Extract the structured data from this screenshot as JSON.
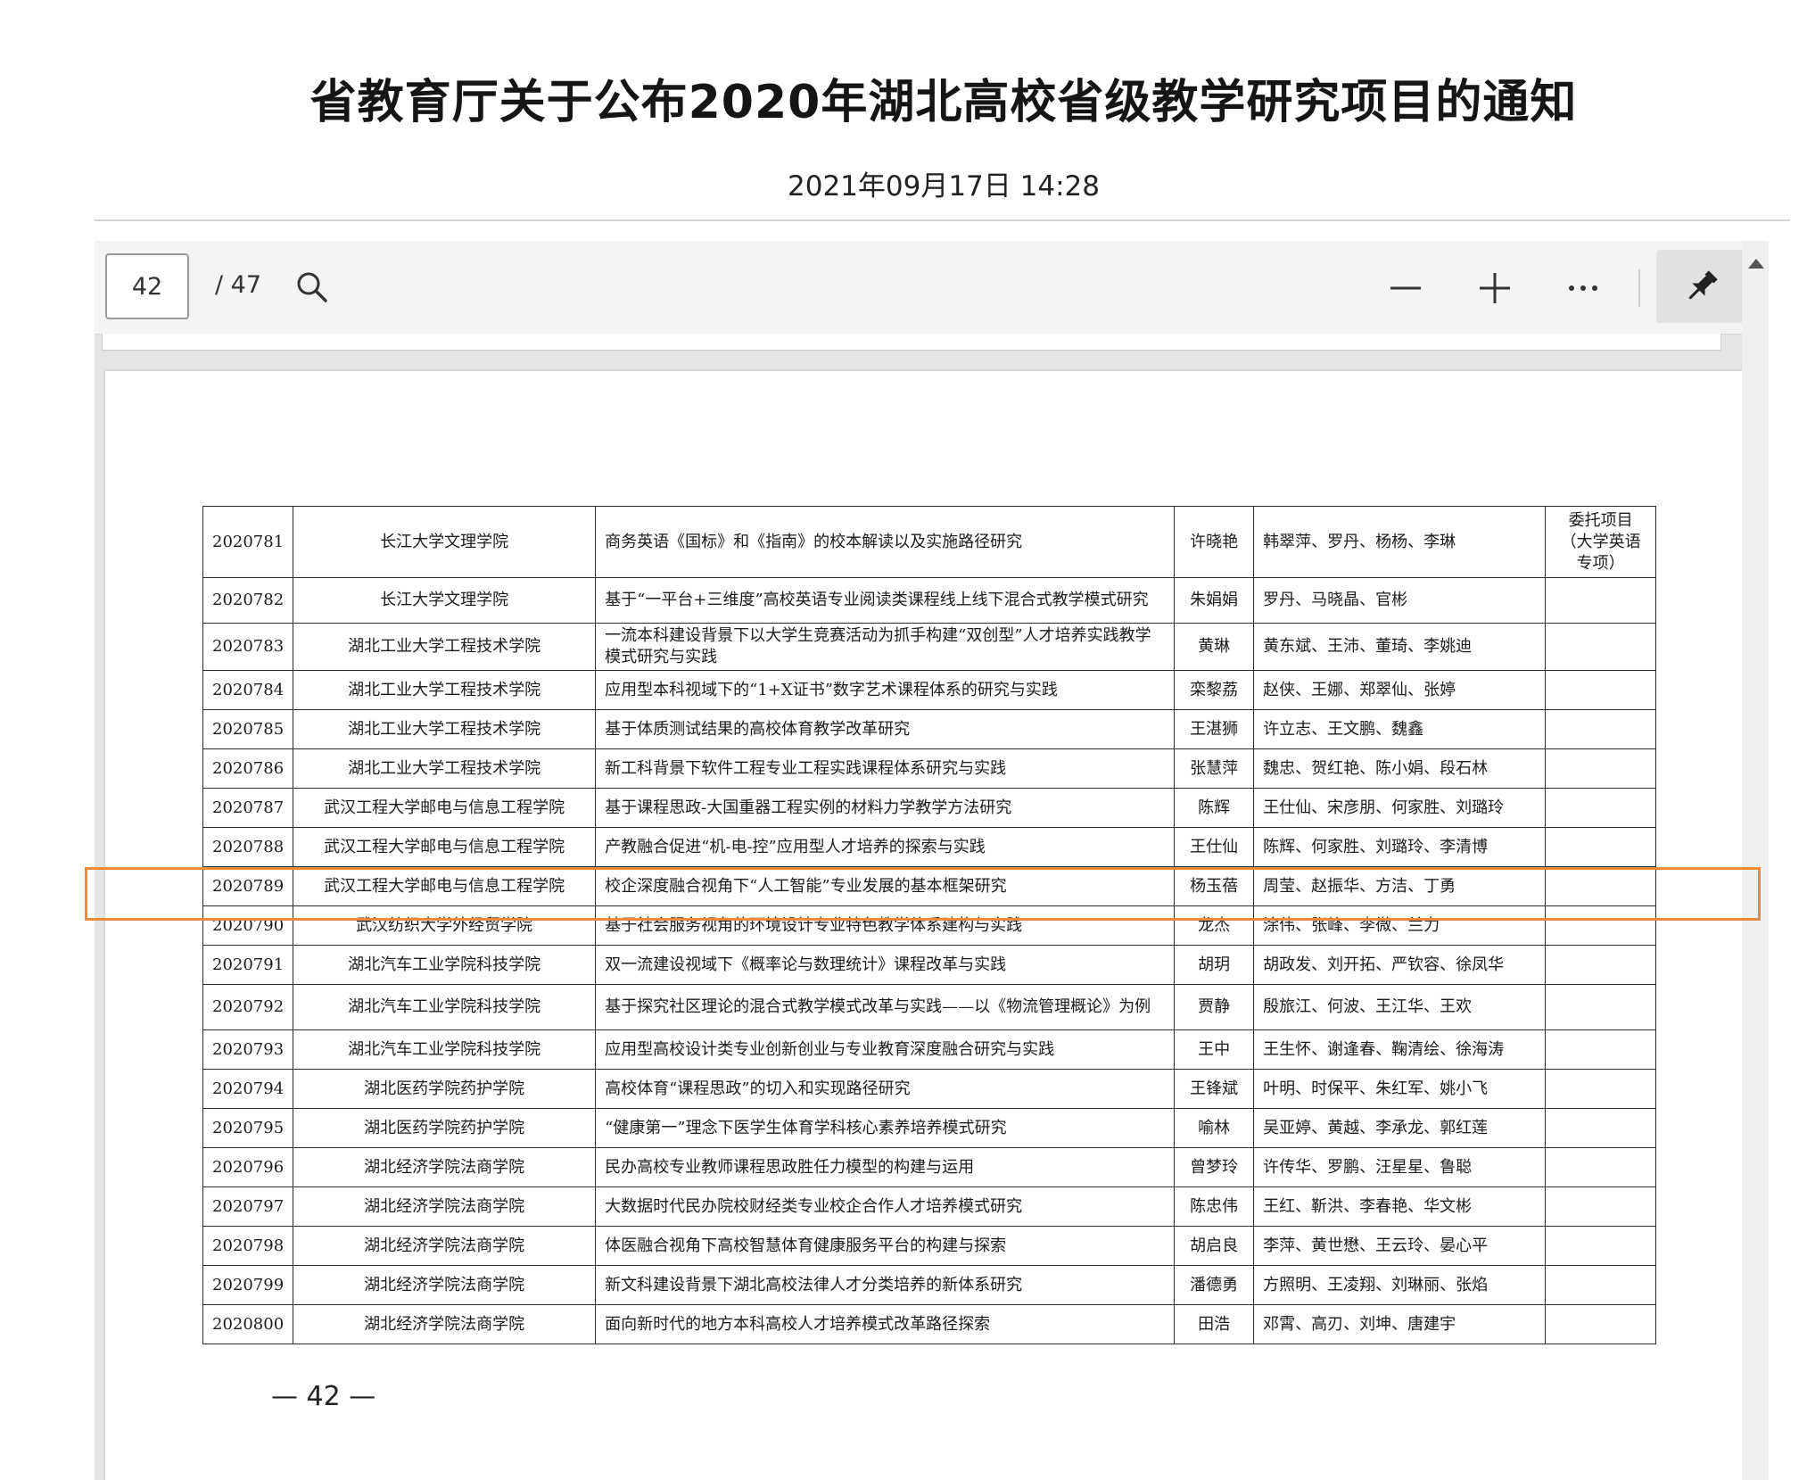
{
  "header": {
    "title": "省教育厅关于公布2020年湖北高校省级教学研究项目的通知",
    "date": "2021年09月17日 14:28"
  },
  "toolbar": {
    "page_current": "42",
    "page_total": "/ 47",
    "icons": [
      "search-icon",
      "zoom-out-icon",
      "zoom-in-icon",
      "more-icon",
      "pin-icon"
    ]
  },
  "document": {
    "page_number": "— 42 —",
    "rows": [
      {
        "id": "2020781",
        "unit": "长江大学文理学院",
        "title": "商务英语《国标》和《指南》的校本解读以及实施路径研究",
        "leader": "许晓艳",
        "members": "韩翠萍、罗丹、杨杨、李琳",
        "note": "委托项目（大学英语专项）"
      },
      {
        "id": "2020782",
        "unit": "长江大学文理学院",
        "title": "基于“一平台+三维度”高校英语专业阅读类课程线上线下混合式教学模式研究",
        "leader": "朱娟娟",
        "members": "罗丹、马晓晶、官彬",
        "note": ""
      },
      {
        "id": "2020783",
        "unit": "湖北工业大学工程技术学院",
        "title": "一流本科建设背景下以大学生竞赛活动为抓手构建“双创型”人才培养实践教学模式研究与实践",
        "leader": "黄琳",
        "members": "黄东斌、王沛、董琦、李姚迪",
        "note": ""
      },
      {
        "id": "2020784",
        "unit": "湖北工业大学工程技术学院",
        "title": "应用型本科视域下的“1+X证书”数字艺术课程体系的研究与实践",
        "leader": "栾黎荔",
        "members": "赵侠、王娜、郑翠仙、张婷",
        "note": ""
      },
      {
        "id": "2020785",
        "unit": "湖北工业大学工程技术学院",
        "title": "基于体质测试结果的高校体育教学改革研究",
        "leader": "王湛狮",
        "members": "许立志、王文鹏、魏鑫",
        "note": ""
      },
      {
        "id": "2020786",
        "unit": "湖北工业大学工程技术学院",
        "title": "新工科背景下软件工程专业工程实践课程体系研究与实践",
        "leader": "张慧萍",
        "members": "魏忠、贺红艳、陈小娟、段石林",
        "note": ""
      },
      {
        "id": "2020787",
        "unit": "武汉工程大学邮电与信息工程学院",
        "title": "基于课程思政-大国重器工程实例的材料力学教学方法研究",
        "leader": "陈辉",
        "members": "王仕仙、宋彦朋、何家胜、刘璐玲",
        "note": ""
      },
      {
        "id": "2020788",
        "unit": "武汉工程大学邮电与信息工程学院",
        "title": "产教融合促进“机-电-控”应用型人才培养的探索与实践",
        "leader": "王仕仙",
        "members": "陈辉、何家胜、刘璐玲、李清博",
        "note": ""
      },
      {
        "id": "2020789",
        "unit": "武汉工程大学邮电与信息工程学院",
        "title": "校企深度融合视角下“人工智能”专业发展的基本框架研究",
        "leader": "杨玉蓓",
        "members": "周莹、赵振华、方洁、丁勇",
        "note": ""
      },
      {
        "id": "2020790",
        "unit": "武汉纺织大学外经贸学院",
        "title": "基于社会服务视角的环境设计专业特色教学体系建构与实践",
        "leader": "龙杰",
        "members": "涂伟、张峰、李微、兰力",
        "note": ""
      },
      {
        "id": "2020791",
        "unit": "湖北汽车工业学院科技学院",
        "title": "双一流建设视域下《概率论与数理统计》课程改革与实践",
        "leader": "胡玥",
        "members": "胡政发、刘开拓、严钦容、徐凤华",
        "note": ""
      },
      {
        "id": "2020792",
        "unit": "湖北汽车工业学院科技学院",
        "title": "基于探究社区理论的混合式教学模式改革与实践——以《物流管理概论》为例",
        "leader": "贾静",
        "members": "殷旅江、何波、王江华、王欢",
        "note": ""
      },
      {
        "id": "2020793",
        "unit": "湖北汽车工业学院科技学院",
        "title": "应用型高校设计类专业创新创业与专业教育深度融合研究与实践",
        "leader": "王中",
        "members": "王生怀、谢逢春、鞠清绘、徐海涛",
        "note": ""
      },
      {
        "id": "2020794",
        "unit": "湖北医药学院药护学院",
        "title": "高校体育“课程思政”的切入和实现路径研究",
        "leader": "王锋斌",
        "members": "叶明、时保平、朱红军、姚小飞",
        "note": ""
      },
      {
        "id": "2020795",
        "unit": "湖北医药学院药护学院",
        "title": "“健康第一”理念下医学生体育学科核心素养培养模式研究",
        "leader": "喻林",
        "members": "吴亚婷、黄越、李承龙、郭红莲",
        "note": ""
      },
      {
        "id": "2020796",
        "unit": "湖北经济学院法商学院",
        "title": "民办高校专业教师课程思政胜任力模型的构建与运用",
        "leader": "曾梦玲",
        "members": "许传华、罗鹏、汪星星、鲁聪",
        "note": ""
      },
      {
        "id": "2020797",
        "unit": "湖北经济学院法商学院",
        "title": "大数据时代民办院校财经类专业校企合作人才培养模式研究",
        "leader": "陈忠伟",
        "members": "王红、靳洪、李春艳、华文彬",
        "note": ""
      },
      {
        "id": "2020798",
        "unit": "湖北经济学院法商学院",
        "title": "体医融合视角下高校智慧体育健康服务平台的构建与探索",
        "leader": "胡启良",
        "members": "李萍、黄世懋、王云玲、晏心平",
        "note": ""
      },
      {
        "id": "2020799",
        "unit": "湖北经济学院法商学院",
        "title": "新文科建设背景下湖北高校法律人才分类培养的新体系研究",
        "leader": "潘德勇",
        "members": "方照明、王凌翔、刘琳丽、张焰",
        "note": ""
      },
      {
        "id": "2020800",
        "unit": "湖北经济学院法商学院",
        "title": "面向新时代的地方本科高校人才培养模式改革路径探索",
        "leader": "田浩",
        "members": "邓霄、高刃、刘坤、唐建宇",
        "note": ""
      }
    ]
  },
  "highlight": {
    "row_id": "2020789",
    "color": "#ef8a3c"
  }
}
